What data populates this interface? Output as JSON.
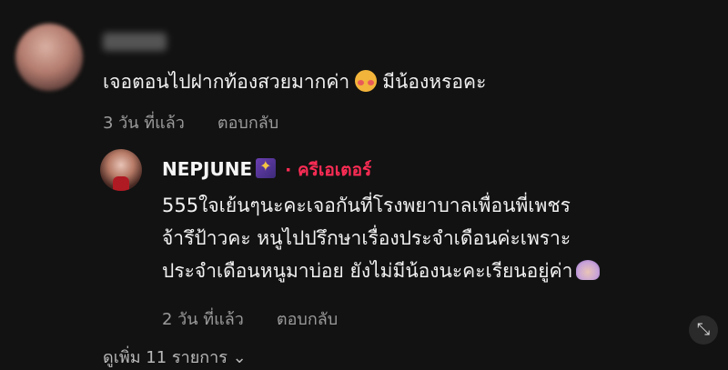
{
  "comment": {
    "text_before_emoji": "เจอตอนไปฝากท้องสวยมากค่า",
    "emoji": "smiling-face-with-hearts",
    "text_after_emoji": "มีน้องหรอคะ",
    "time": "3 วัน ที่แล้ว",
    "reply_label": "ตอบกลับ"
  },
  "reply": {
    "username": "NEPJUNE",
    "badge": "sparkle-badge",
    "creator_label": "· ครีเอเตอร์",
    "lines": [
      "555ใจเย้นๆนะคะเจอกันที่โรงพยาบาลเพื่อนพี่เพชร",
      "จ้ารึป้าวคะ หนูไปปรึกษาเรื่องประจำเดือนค่ะเพราะ",
      "ประจำเดือนหนูมาบ่อย ยังไม่มีน้องนะคะเรียนอยู่ค่า"
    ],
    "emoji": "praying-hands",
    "time": "2 วัน ที่แล้ว",
    "reply_label": "ตอบกลับ"
  },
  "more_replies": "ดูเพิ่ม 11 รายการ ⌄",
  "expand": "⤡"
}
